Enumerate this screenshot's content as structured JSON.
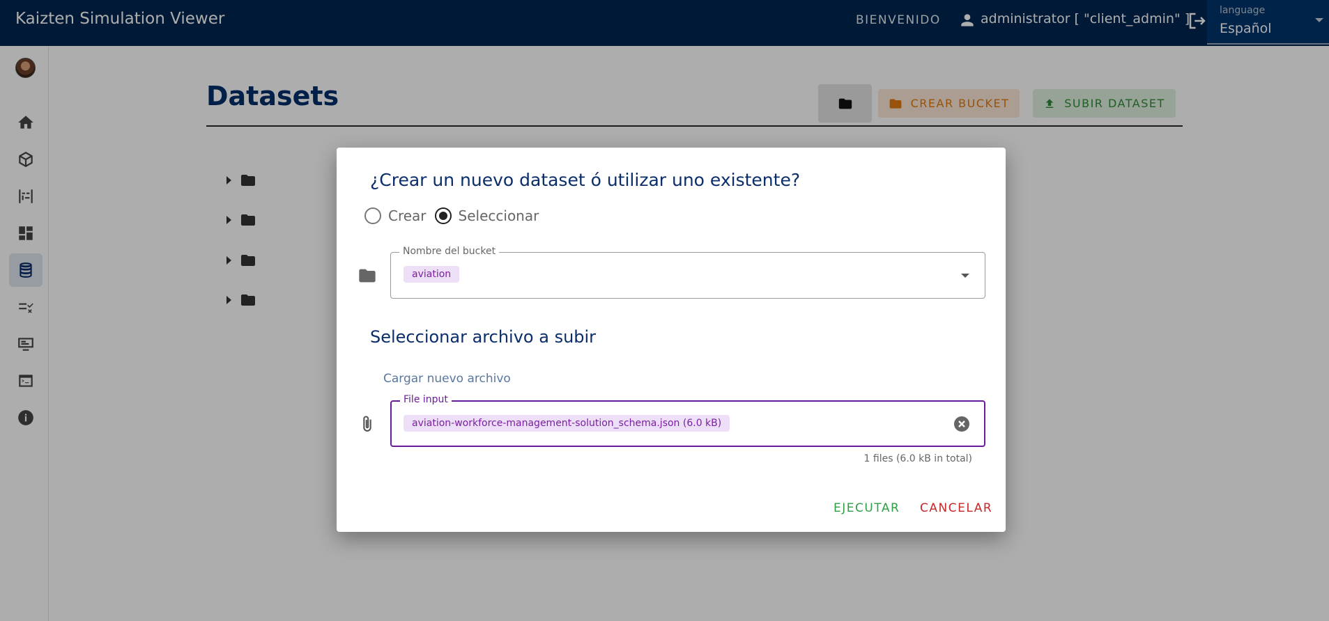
{
  "appbar": {
    "title": "Kaizten Simulation Viewer",
    "welcome": "BIENVENIDO",
    "user": "administrator [ \"client_admin\" ]",
    "language_label": "language",
    "language_value": "Español"
  },
  "sidebar": {
    "items": [
      {
        "icon": "home-icon"
      },
      {
        "icon": "cube-icon"
      },
      {
        "icon": "timeline-icon"
      },
      {
        "icon": "dashboard-icon"
      },
      {
        "icon": "database-icon",
        "active": true
      },
      {
        "icon": "checklist-icon"
      },
      {
        "icon": "monitor-icon"
      },
      {
        "icon": "terminal-icon"
      },
      {
        "icon": "info-icon"
      }
    ]
  },
  "page": {
    "title": "Datasets",
    "create_bucket_label": "CREAR BUCKET",
    "upload_dataset_label": "SUBIR DATASET"
  },
  "dialog": {
    "title": "¿Crear un nuevo dataset ó utilizar uno existente?",
    "radio_create": "Crear",
    "radio_select": "Seleccionar",
    "bucket_label": "Nombre del bucket",
    "bucket_value": "aviation",
    "section_title": "Seleccionar archivo a subir",
    "upload_link": "Cargar nuevo archivo",
    "file_label": "File input",
    "file_chip": "aviation-workforce-management-solution_schema.json (6.0 kB)",
    "file_summary": "1 files (6.0 kB in total)",
    "execute_label": "EJECUTAR",
    "cancel_label": "CANCELAR"
  },
  "colors": {
    "appbar": "#002550",
    "title": "#002f6c",
    "accent_purple": "#6a1b9a",
    "execute": "#2f9e44",
    "cancel": "#c62828"
  }
}
